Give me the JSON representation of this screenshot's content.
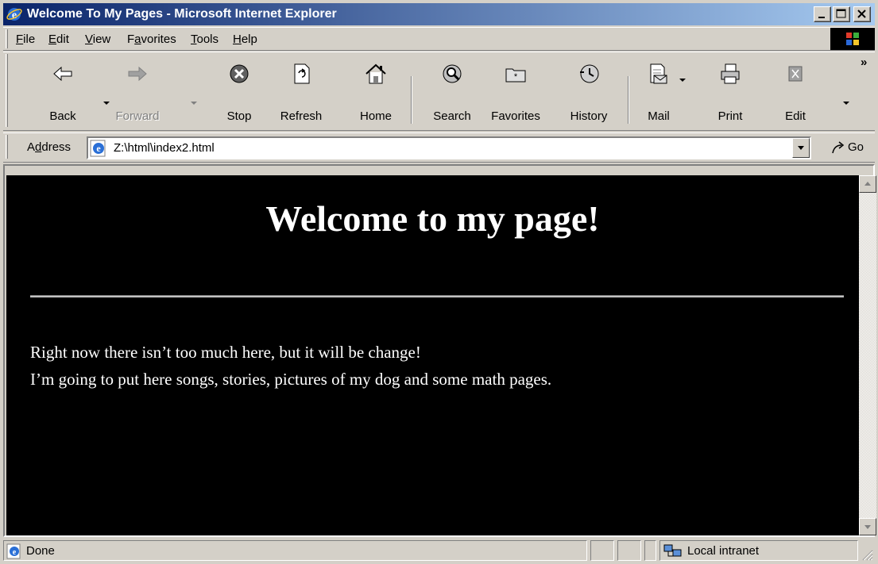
{
  "window": {
    "title": "Welcome To My Pages - Microsoft Internet Explorer"
  },
  "menu": {
    "items": [
      {
        "label": "File",
        "key": "F",
        "rest": "ile"
      },
      {
        "label": "Edit",
        "key": "E",
        "rest": "dit"
      },
      {
        "label": "View",
        "key": "V",
        "rest": "iew"
      },
      {
        "label": "Favorites",
        "pre": "F",
        "key": "a",
        "rest": "vorites"
      },
      {
        "label": "Tools",
        "key": "T",
        "rest": "ools"
      },
      {
        "label": "Help",
        "key": "H",
        "rest": "elp"
      }
    ]
  },
  "toolbar": {
    "buttons": [
      {
        "label": "Back",
        "icon": "back-arrow-icon"
      },
      {
        "label": "Forward",
        "icon": "forward-arrow-icon"
      },
      {
        "label": "Stop",
        "icon": "stop-icon"
      },
      {
        "label": "Refresh",
        "icon": "refresh-icon"
      },
      {
        "label": "Home",
        "icon": "home-icon"
      },
      {
        "label": "Search",
        "icon": "search-icon"
      },
      {
        "label": "Favorites",
        "icon": "favorites-folder-icon"
      },
      {
        "label": "History",
        "icon": "history-icon"
      },
      {
        "label": "Mail",
        "icon": "mail-icon"
      },
      {
        "label": "Print",
        "icon": "printer-icon"
      },
      {
        "label": "Edit",
        "icon": "edit-icon"
      }
    ],
    "more": "»"
  },
  "address": {
    "label": "Address",
    "label_key": "d",
    "url": "Z:\\html\\index2.html",
    "go": "Go"
  },
  "page": {
    "heading": "Welcome to my page!",
    "line1": "Right now there isn’t too much here, but it will be change!",
    "line2": "I’m going to put here songs, stories, pictures of my dog and some math pages.",
    "background": "#000000",
    "text_color": "#ffffff"
  },
  "status": {
    "text": "Done",
    "zone": "Local intranet"
  },
  "colors": {
    "titlebar_start": "#0a246a",
    "titlebar_end": "#a6caf0",
    "chrome": "#d4d0c8"
  }
}
